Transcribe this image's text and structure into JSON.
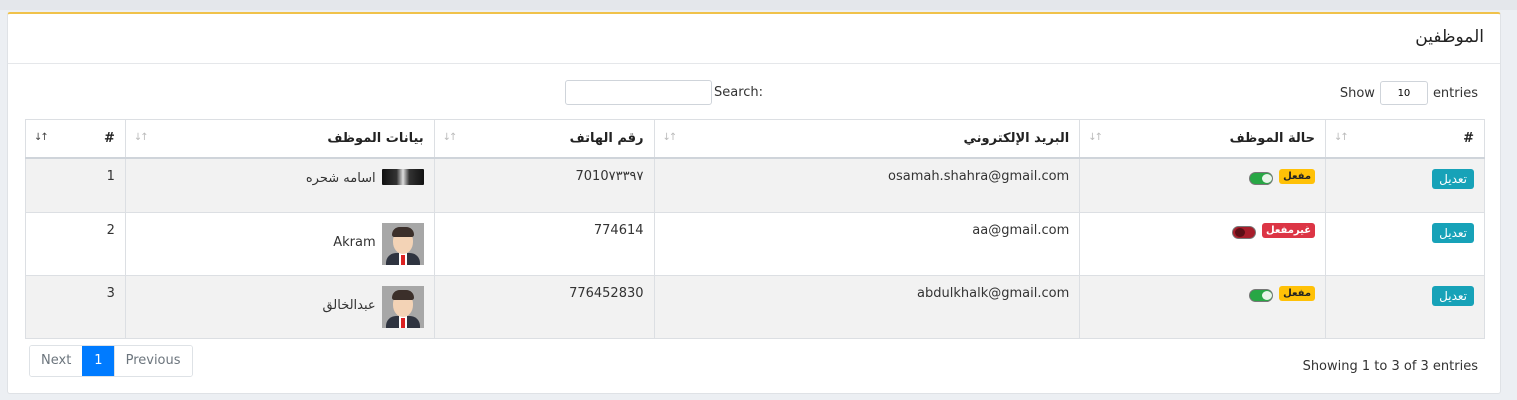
{
  "page": {
    "title": "الموظفين"
  },
  "controls": {
    "show_label": "Show",
    "show_value": "10",
    "entries_label": "entries",
    "search_label": "Search:"
  },
  "table": {
    "headers": [
      "#",
      "بيانات الموظف",
      "رقم الهاتف",
      "البريد الإلكتروني",
      "حالة الموظف",
      "#"
    ],
    "rows": [
      {
        "index": "1",
        "name": "اسامه شحره",
        "phone": "7010٧٣٣٩٧",
        "email": "osamah.shahra@gmail.com",
        "status_label": "مفعل",
        "status": "on",
        "action": "تعديل"
      },
      {
        "index": "2",
        "name": "Akram",
        "phone": "774614",
        "email": "aa@gmail.com",
        "status_label": "غيرمفعل",
        "status": "off",
        "action": "تعديل"
      },
      {
        "index": "3",
        "name": "عبدالخالق",
        "phone": "776452830",
        "email": "abdulkhalk@gmail.com",
        "status_label": "مفعل",
        "status": "on",
        "action": "تعديل"
      }
    ]
  },
  "footer": {
    "info": "Showing 1 to 3 of 3 entries",
    "next": "Next",
    "page": "1",
    "previous": "Previous"
  },
  "colors": {
    "accent": "#f0c24b",
    "primary": "#007bff",
    "edit_button": "#17a2b8",
    "badge_on": "#ffc107",
    "badge_off": "#dc3545"
  }
}
